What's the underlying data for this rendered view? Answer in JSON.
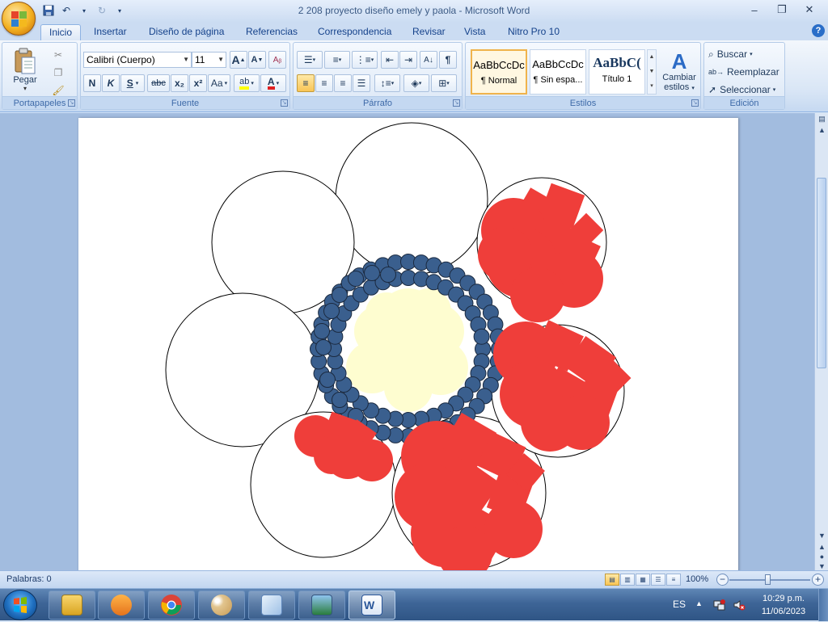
{
  "window": {
    "title": "2 208 proyecto diseño emely y paola - Microsoft Word"
  },
  "tabs": [
    {
      "label": "Inicio",
      "active": true
    },
    {
      "label": "Insertar"
    },
    {
      "label": "Diseño de página"
    },
    {
      "label": "Referencias"
    },
    {
      "label": "Correspondencia"
    },
    {
      "label": "Revisar"
    },
    {
      "label": "Vista"
    },
    {
      "label": "Nitro Pro 10"
    }
  ],
  "ribbon": {
    "clipboard": {
      "label": "Portapapeles",
      "paste_label": "Pegar"
    },
    "font": {
      "label": "Fuente",
      "font_name": "Calibri (Cuerpo)",
      "font_size": "11",
      "bold": "N",
      "italic": "K",
      "underline": "S",
      "strike": "abc",
      "subscript": "x₂",
      "superscript": "x²",
      "change_case": "Aa",
      "grow": "A",
      "shrink": "A"
    },
    "paragraph": {
      "label": "Párrafo"
    },
    "styles": {
      "label": "Estilos",
      "items": [
        {
          "sample": "AaBbCcDc",
          "name": "¶ Normal",
          "selected": true
        },
        {
          "sample": "AaBbCcDc",
          "name": "¶ Sin espa..."
        },
        {
          "sample": "AaBbC(",
          "name": "Título 1"
        }
      ],
      "change_styles_line1": "Cambiar",
      "change_styles_line2": "estilos"
    },
    "editing": {
      "label": "Edición",
      "find": "Buscar",
      "replace": "Reemplazar",
      "select": "Seleccionar"
    }
  },
  "status": {
    "words": "Palabras: 0",
    "zoom": "100%",
    "zoom_percent": 100
  },
  "taskbar": {
    "lang": "ES",
    "time": "10:29 p.m.",
    "date": "11/06/2023"
  },
  "colors": {
    "petal_red": "#ef3e3a",
    "center_cream": "#fefdd0",
    "center_dot": "#3a5f8e",
    "dot_stroke": "#1b2a40"
  }
}
